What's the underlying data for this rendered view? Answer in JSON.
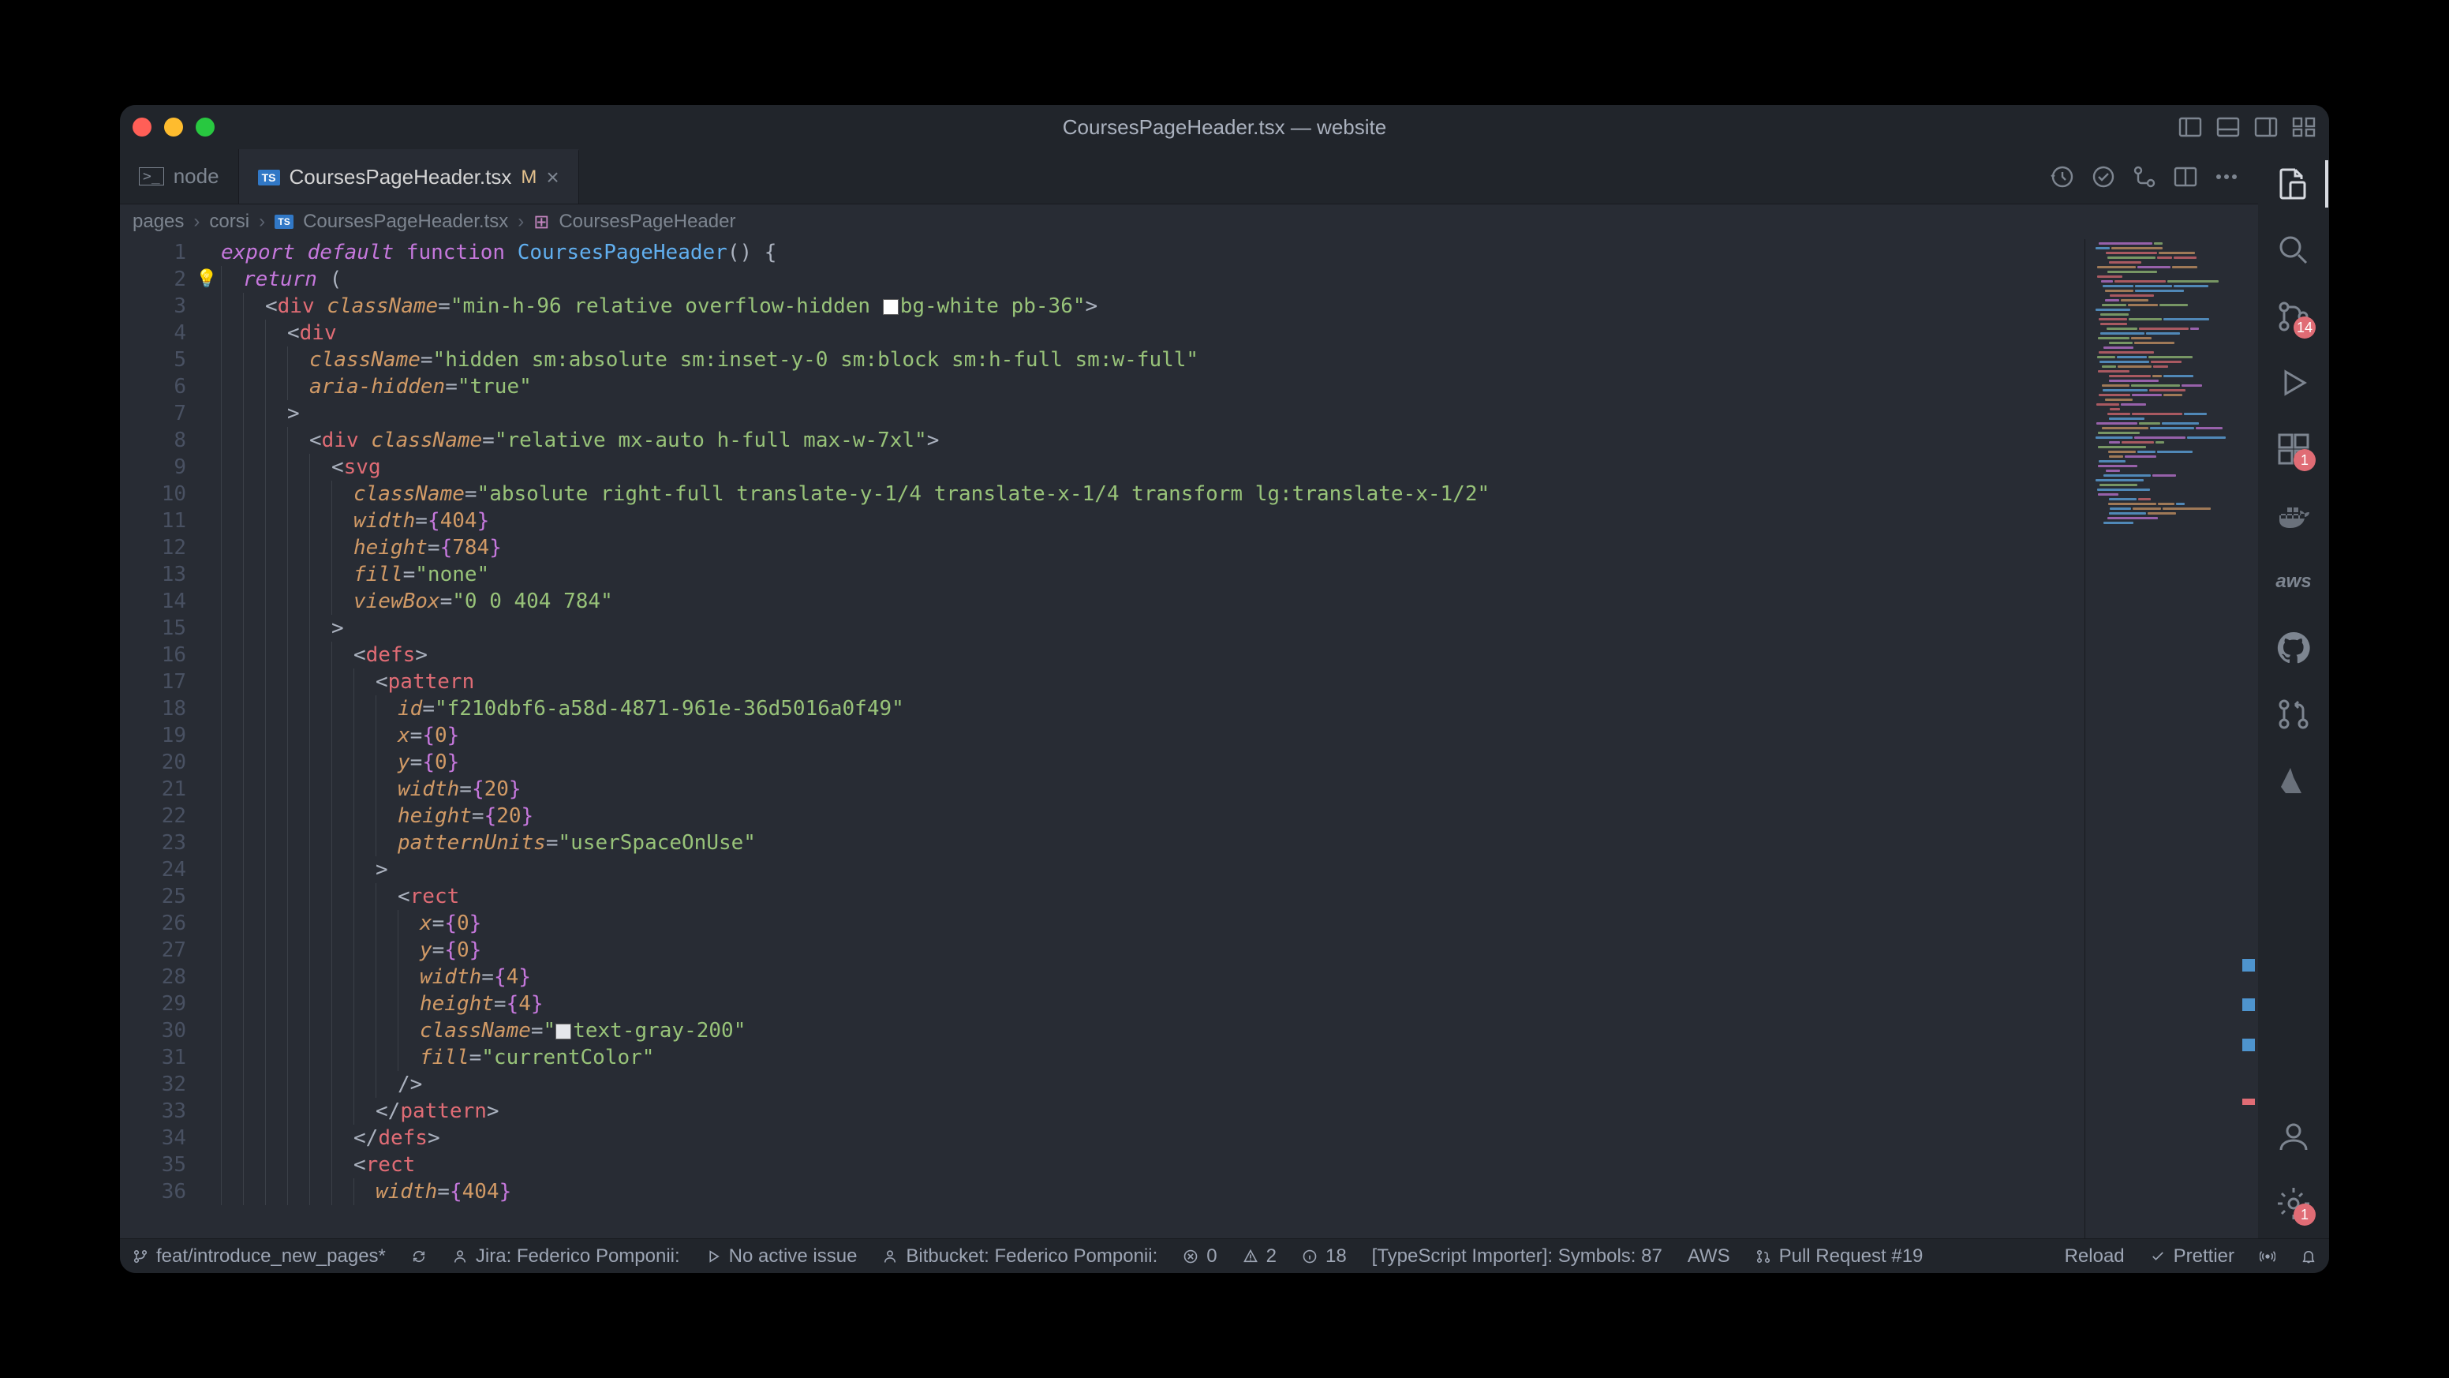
{
  "window": {
    "title": "CoursesPageHeader.tsx — website"
  },
  "tabs": [
    {
      "icon": "terminal",
      "label": "node",
      "active": false
    },
    {
      "icon": "ts",
      "label": "CoursesPageHeader.tsx",
      "modified": "M",
      "active": true
    }
  ],
  "breadcrumb": {
    "items": [
      "pages",
      "corsi",
      "CoursesPageHeader.tsx",
      "CoursesPageHeader"
    ]
  },
  "code": {
    "lines": [
      {
        "n": 1,
        "indent": 0,
        "segments": [
          {
            "t": "export",
            "c": "tk-keyword-it"
          },
          {
            "t": " "
          },
          {
            "t": "default",
            "c": "tk-keyword-it"
          },
          {
            "t": " "
          },
          {
            "t": "function",
            "c": "tk-keyword"
          },
          {
            "t": " "
          },
          {
            "t": "CoursesPageHeader",
            "c": "tk-fn"
          },
          {
            "t": "() {",
            "c": "tk-punct"
          }
        ]
      },
      {
        "n": 2,
        "indent": 1,
        "bulb": true,
        "segments": [
          {
            "t": "return",
            "c": "tk-keyword-it"
          },
          {
            "t": " (",
            "c": "tk-punct"
          }
        ]
      },
      {
        "n": 3,
        "indent": 2,
        "segments": [
          {
            "t": "<",
            "c": "tk-punct"
          },
          {
            "t": "div",
            "c": "tk-tag"
          },
          {
            "t": " "
          },
          {
            "t": "className",
            "c": "tk-attr"
          },
          {
            "t": "=",
            "c": "tk-punct"
          },
          {
            "t": "\"min-h-96 relative overflow-hidden ",
            "c": "tk-string"
          },
          {
            "swatch": "#ffffff"
          },
          {
            "t": "bg-white pb-36\"",
            "c": "tk-string"
          },
          {
            "t": ">",
            "c": "tk-punct"
          }
        ]
      },
      {
        "n": 4,
        "indent": 3,
        "segments": [
          {
            "t": "<",
            "c": "tk-punct"
          },
          {
            "t": "div",
            "c": "tk-tag"
          }
        ]
      },
      {
        "n": 5,
        "indent": 4,
        "segments": [
          {
            "t": "className",
            "c": "tk-attr"
          },
          {
            "t": "=",
            "c": "tk-punct"
          },
          {
            "t": "\"hidden sm:absolute sm:inset-y-0 sm:block sm:h-full sm:w-full\"",
            "c": "tk-string"
          }
        ]
      },
      {
        "n": 6,
        "indent": 4,
        "segments": [
          {
            "t": "aria-hidden",
            "c": "tk-attr"
          },
          {
            "t": "=",
            "c": "tk-punct"
          },
          {
            "t": "\"true\"",
            "c": "tk-string"
          }
        ]
      },
      {
        "n": 7,
        "indent": 3,
        "segments": [
          {
            "t": ">",
            "c": "tk-punct"
          }
        ]
      },
      {
        "n": 8,
        "indent": 4,
        "segments": [
          {
            "t": "<",
            "c": "tk-punct"
          },
          {
            "t": "div",
            "c": "tk-tag"
          },
          {
            "t": " "
          },
          {
            "t": "className",
            "c": "tk-attr"
          },
          {
            "t": "=",
            "c": "tk-punct"
          },
          {
            "t": "\"relative mx-auto h-full max-w-7xl\"",
            "c": "tk-string"
          },
          {
            "t": ">",
            "c": "tk-punct"
          }
        ]
      },
      {
        "n": 9,
        "indent": 5,
        "segments": [
          {
            "t": "<",
            "c": "tk-punct"
          },
          {
            "t": "svg",
            "c": "tk-tag"
          }
        ]
      },
      {
        "n": 10,
        "indent": 6,
        "segments": [
          {
            "t": "className",
            "c": "tk-attr"
          },
          {
            "t": "=",
            "c": "tk-punct"
          },
          {
            "t": "\"absolute right-full translate-y-1/4 translate-x-1/4 transform lg:translate-x-1/2\"",
            "c": "tk-string"
          }
        ]
      },
      {
        "n": 11,
        "indent": 6,
        "segments": [
          {
            "t": "width",
            "c": "tk-attr"
          },
          {
            "t": "=",
            "c": "tk-punct"
          },
          {
            "t": "{",
            "c": "tk-brace"
          },
          {
            "t": "404",
            "c": "tk-num"
          },
          {
            "t": "}",
            "c": "tk-brace"
          }
        ]
      },
      {
        "n": 12,
        "indent": 6,
        "segments": [
          {
            "t": "height",
            "c": "tk-attr"
          },
          {
            "t": "=",
            "c": "tk-punct"
          },
          {
            "t": "{",
            "c": "tk-brace"
          },
          {
            "t": "784",
            "c": "tk-num"
          },
          {
            "t": "}",
            "c": "tk-brace"
          }
        ]
      },
      {
        "n": 13,
        "indent": 6,
        "segments": [
          {
            "t": "fill",
            "c": "tk-attr"
          },
          {
            "t": "=",
            "c": "tk-punct"
          },
          {
            "t": "\"none\"",
            "c": "tk-string"
          }
        ]
      },
      {
        "n": 14,
        "indent": 6,
        "segments": [
          {
            "t": "viewBox",
            "c": "tk-attr"
          },
          {
            "t": "=",
            "c": "tk-punct"
          },
          {
            "t": "\"0 0 404 784\"",
            "c": "tk-string"
          }
        ]
      },
      {
        "n": 15,
        "indent": 5,
        "segments": [
          {
            "t": ">",
            "c": "tk-punct"
          }
        ]
      },
      {
        "n": 16,
        "indent": 6,
        "segments": [
          {
            "t": "<",
            "c": "tk-punct"
          },
          {
            "t": "defs",
            "c": "tk-tag"
          },
          {
            "t": ">",
            "c": "tk-punct"
          }
        ]
      },
      {
        "n": 17,
        "indent": 7,
        "segments": [
          {
            "t": "<",
            "c": "tk-punct"
          },
          {
            "t": "pattern",
            "c": "tk-tag"
          }
        ]
      },
      {
        "n": 18,
        "indent": 8,
        "segments": [
          {
            "t": "id",
            "c": "tk-attr"
          },
          {
            "t": "=",
            "c": "tk-punct"
          },
          {
            "t": "\"f210dbf6-a58d-4871-961e-36d5016a0f49\"",
            "c": "tk-string"
          }
        ]
      },
      {
        "n": 19,
        "indent": 8,
        "segments": [
          {
            "t": "x",
            "c": "tk-attr"
          },
          {
            "t": "=",
            "c": "tk-punct"
          },
          {
            "t": "{",
            "c": "tk-brace"
          },
          {
            "t": "0",
            "c": "tk-num"
          },
          {
            "t": "}",
            "c": "tk-brace"
          }
        ]
      },
      {
        "n": 20,
        "indent": 8,
        "segments": [
          {
            "t": "y",
            "c": "tk-attr"
          },
          {
            "t": "=",
            "c": "tk-punct"
          },
          {
            "t": "{",
            "c": "tk-brace"
          },
          {
            "t": "0",
            "c": "tk-num"
          },
          {
            "t": "}",
            "c": "tk-brace"
          }
        ]
      },
      {
        "n": 21,
        "indent": 8,
        "segments": [
          {
            "t": "width",
            "c": "tk-attr"
          },
          {
            "t": "=",
            "c": "tk-punct"
          },
          {
            "t": "{",
            "c": "tk-brace"
          },
          {
            "t": "20",
            "c": "tk-num"
          },
          {
            "t": "}",
            "c": "tk-brace"
          }
        ]
      },
      {
        "n": 22,
        "indent": 8,
        "segments": [
          {
            "t": "height",
            "c": "tk-attr"
          },
          {
            "t": "=",
            "c": "tk-punct"
          },
          {
            "t": "{",
            "c": "tk-brace"
          },
          {
            "t": "20",
            "c": "tk-num"
          },
          {
            "t": "}",
            "c": "tk-brace"
          }
        ]
      },
      {
        "n": 23,
        "indent": 8,
        "segments": [
          {
            "t": "patternUnits",
            "c": "tk-attr"
          },
          {
            "t": "=",
            "c": "tk-punct"
          },
          {
            "t": "\"userSpaceOnUse\"",
            "c": "tk-string"
          }
        ]
      },
      {
        "n": 24,
        "indent": 7,
        "segments": [
          {
            "t": ">",
            "c": "tk-punct"
          }
        ]
      },
      {
        "n": 25,
        "indent": 8,
        "segments": [
          {
            "t": "<",
            "c": "tk-punct"
          },
          {
            "t": "rect",
            "c": "tk-tag"
          }
        ]
      },
      {
        "n": 26,
        "indent": 9,
        "segments": [
          {
            "t": "x",
            "c": "tk-attr"
          },
          {
            "t": "=",
            "c": "tk-punct"
          },
          {
            "t": "{",
            "c": "tk-brace"
          },
          {
            "t": "0",
            "c": "tk-num"
          },
          {
            "t": "}",
            "c": "tk-brace"
          }
        ]
      },
      {
        "n": 27,
        "indent": 9,
        "segments": [
          {
            "t": "y",
            "c": "tk-attr"
          },
          {
            "t": "=",
            "c": "tk-punct"
          },
          {
            "t": "{",
            "c": "tk-brace"
          },
          {
            "t": "0",
            "c": "tk-num"
          },
          {
            "t": "}",
            "c": "tk-brace"
          }
        ]
      },
      {
        "n": 28,
        "indent": 9,
        "segments": [
          {
            "t": "width",
            "c": "tk-attr"
          },
          {
            "t": "=",
            "c": "tk-punct"
          },
          {
            "t": "{",
            "c": "tk-brace"
          },
          {
            "t": "4",
            "c": "tk-num"
          },
          {
            "t": "}",
            "c": "tk-brace"
          }
        ]
      },
      {
        "n": 29,
        "indent": 9,
        "segments": [
          {
            "t": "height",
            "c": "tk-attr"
          },
          {
            "t": "=",
            "c": "tk-punct"
          },
          {
            "t": "{",
            "c": "tk-brace"
          },
          {
            "t": "4",
            "c": "tk-num"
          },
          {
            "t": "}",
            "c": "tk-brace"
          }
        ]
      },
      {
        "n": 30,
        "indent": 9,
        "segments": [
          {
            "t": "className",
            "c": "tk-attr"
          },
          {
            "t": "=",
            "c": "tk-punct"
          },
          {
            "t": "\"",
            "c": "tk-string"
          },
          {
            "swatch": "#e5e7eb"
          },
          {
            "t": "text-gray-200\"",
            "c": "tk-string"
          }
        ]
      },
      {
        "n": 31,
        "indent": 9,
        "segments": [
          {
            "t": "fill",
            "c": "tk-attr"
          },
          {
            "t": "=",
            "c": "tk-punct"
          },
          {
            "t": "\"currentColor\"",
            "c": "tk-string"
          }
        ]
      },
      {
        "n": 32,
        "indent": 8,
        "segments": [
          {
            "t": "/>",
            "c": "tk-punct"
          }
        ]
      },
      {
        "n": 33,
        "indent": 7,
        "segments": [
          {
            "t": "</",
            "c": "tk-punct"
          },
          {
            "t": "pattern",
            "c": "tk-tag"
          },
          {
            "t": ">",
            "c": "tk-punct"
          }
        ]
      },
      {
        "n": 34,
        "indent": 6,
        "segments": [
          {
            "t": "</",
            "c": "tk-punct"
          },
          {
            "t": "defs",
            "c": "tk-tag"
          },
          {
            "t": ">",
            "c": "tk-punct"
          }
        ]
      },
      {
        "n": 35,
        "indent": 6,
        "segments": [
          {
            "t": "<",
            "c": "tk-punct"
          },
          {
            "t": "rect",
            "c": "tk-tag"
          }
        ]
      },
      {
        "n": 36,
        "indent": 7,
        "segments": [
          {
            "t": "width",
            "c": "tk-attr"
          },
          {
            "t": "=",
            "c": "tk-punct"
          },
          {
            "t": "{",
            "c": "tk-brace"
          },
          {
            "t": "404",
            "c": "tk-num"
          },
          {
            "t": "}",
            "c": "tk-brace"
          }
        ]
      }
    ]
  },
  "activity_bar": {
    "top_icons": [
      {
        "name": "explorer",
        "badge": null,
        "active": true
      },
      {
        "name": "search",
        "badge": null
      },
      {
        "name": "source-control",
        "badge": "14"
      },
      {
        "name": "run-debug",
        "badge": null
      },
      {
        "name": "extensions",
        "badge": "1"
      },
      {
        "name": "docker",
        "badge": null
      },
      {
        "name": "aws",
        "label": "aws",
        "badge": null
      },
      {
        "name": "github",
        "badge": null
      },
      {
        "name": "pull-requests",
        "badge": null
      },
      {
        "name": "atlassian",
        "badge": null
      }
    ],
    "bottom_icons": [
      {
        "name": "account",
        "badge": null
      },
      {
        "name": "settings",
        "badge": "1"
      }
    ]
  },
  "status_bar": {
    "left": [
      {
        "icon": "git-branch",
        "text": "feat/introduce_new_pages*"
      },
      {
        "icon": "sync",
        "text": ""
      },
      {
        "icon": "person",
        "text": "Jira: Federico Pomponii:"
      },
      {
        "icon": "play",
        "text": "No active issue"
      },
      {
        "icon": "person",
        "text": "Bitbucket: Federico Pomponii:"
      },
      {
        "icon": "error",
        "text": "0"
      },
      {
        "icon": "warning",
        "text": "2"
      },
      {
        "icon": "info",
        "text": "18"
      },
      {
        "text": "[TypeScript Importer]: Symbols: 87"
      },
      {
        "text": "AWS"
      },
      {
        "icon": "pr",
        "text": "Pull Request #19"
      }
    ],
    "right": [
      {
        "text": "Reload"
      },
      {
        "icon": "check",
        "text": "Prettier"
      },
      {
        "icon": "broadcast",
        "text": ""
      },
      {
        "icon": "bell",
        "text": ""
      }
    ]
  }
}
